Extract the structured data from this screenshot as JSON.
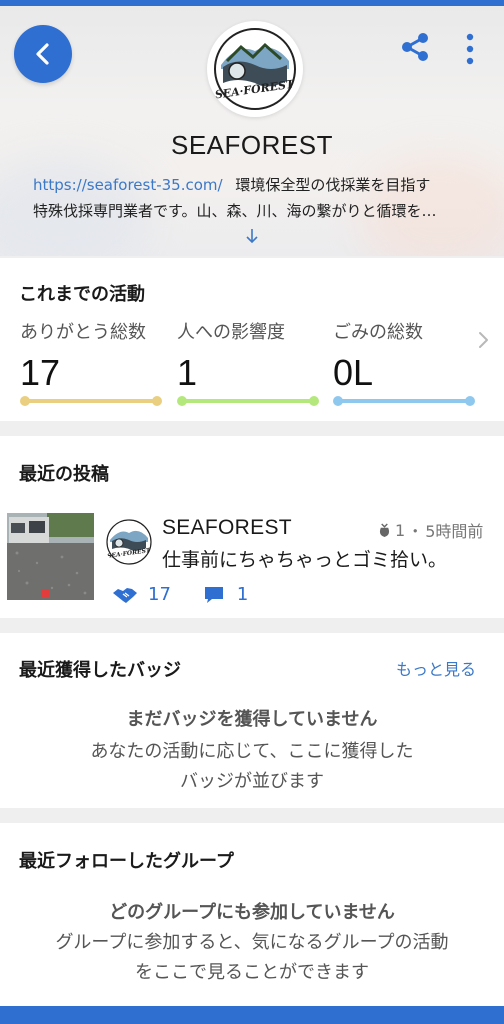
{
  "profile": {
    "name": "SEAFOREST",
    "website": "https://seaforest-35.com/",
    "bio_line1_rest": "環境保全型の伐採業を目指す",
    "bio_line2": "特殊伐採専門業者です。山、森、川、海の繋がりと循環を…",
    "logo_text": "SEA FOREST"
  },
  "activity": {
    "title": "これまでの活動",
    "stats": [
      {
        "label": "ありがとう総数",
        "value": "17",
        "color": "#e9cf7f"
      },
      {
        "label": "人への影響度",
        "value": "1",
        "color": "#b5e87c"
      },
      {
        "label": "ごみの総数",
        "value": "0L",
        "color": "#8fc8ee"
      }
    ]
  },
  "recent_posts": {
    "title": "最近の投稿",
    "post": {
      "author": "SEAFOREST",
      "trash_count": "1",
      "separator": "・",
      "time": "5時間前",
      "text": "仕事前にちゃちゃっとゴミ拾い。",
      "thanks_count": "17",
      "comment_count": "1"
    }
  },
  "badges": {
    "title": "最近獲得したバッジ",
    "more_label": "もっと見る",
    "empty_title": "まだバッジを獲得していません",
    "empty_desc_line1": "あなたの活動に応じて、ここに獲得した",
    "empty_desc_line2": "バッジが並びます"
  },
  "groups": {
    "title": "最近フォローしたグループ",
    "empty_title": "どのグループにも参加していません",
    "empty_desc_line1": "グループに参加すると、気になるグループの活動",
    "empty_desc_line2": "をここで見ることができます"
  },
  "colors": {
    "accent": "#2f6fd2",
    "link": "#3b78c8"
  },
  "icons": {
    "back": "chevron-left-icon",
    "share": "share-icon",
    "more": "more-vertical-icon",
    "expand": "arrow-down-icon",
    "next": "chevron-right-icon",
    "trash": "trash-bag-icon",
    "thanks": "handshake-icon",
    "comment": "comment-icon"
  }
}
